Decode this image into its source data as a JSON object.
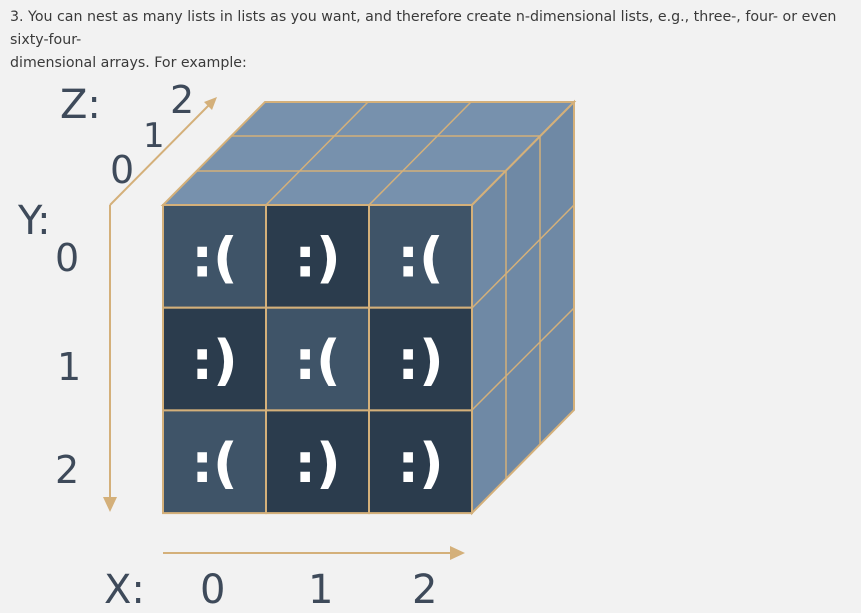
{
  "description": {
    "line1": "3. You can nest as many lists in lists as you want, and therefore create n-dimensional lists, e.g., three-, four- or even sixty-four-",
    "line2": "dimensional arrays. For example:"
  },
  "axes": {
    "z_title": "Z:",
    "y_title": "Y:",
    "x_title": "X:",
    "z_ticks": [
      "0",
      "1",
      "2"
    ],
    "y_ticks": [
      "0",
      "1",
      "2"
    ],
    "x_ticks": [
      "0",
      "1",
      "2"
    ]
  },
  "cells": [
    [
      ":(",
      ":)",
      ":("
    ],
    [
      ":)",
      ":(",
      ":)"
    ],
    [
      ":(",
      ":)",
      ":)"
    ]
  ],
  "colors": {
    "light_cell": "#3f5468",
    "dark_cell": "#2b3c4d",
    "top_face": "#7791ad",
    "side_face": "#6f89a5",
    "grid_line": "#d4b07a",
    "arrow": "#d4b07a",
    "label": "#3e4a5a"
  },
  "cell_shades": [
    [
      "light",
      "dark",
      "light"
    ],
    [
      "dark",
      "light",
      "dark"
    ],
    [
      "light",
      "dark",
      "dark"
    ]
  ]
}
